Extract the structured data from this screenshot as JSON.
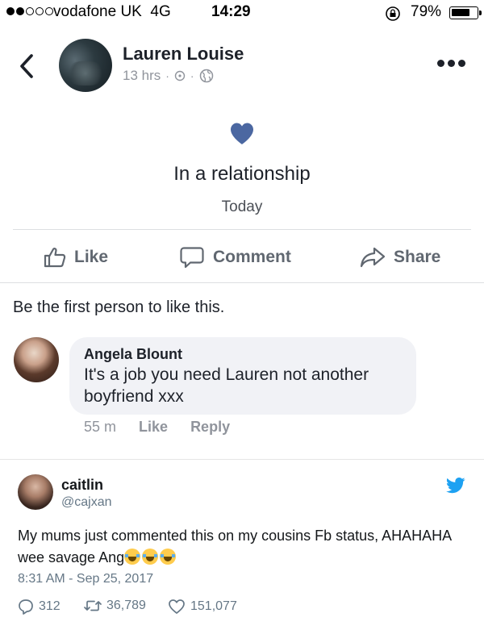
{
  "status_bar": {
    "carrier": "vodafone UK",
    "network": "4G",
    "time": "14:29",
    "battery_percent": "79%",
    "battery_level": 0.79,
    "signal_bars": 2,
    "signal_total": 5
  },
  "post": {
    "author": "Lauren Louise",
    "time": "13 hrs",
    "event_title": "In a relationship",
    "event_date": "Today",
    "heart_color": "#4b67a1",
    "actions": {
      "like": "Like",
      "comment": "Comment",
      "share": "Share"
    },
    "likes_summary": "Be the first person to like this."
  },
  "comment": {
    "author": "Angela Blount",
    "text": "It's a job you need Lauren not another boyfriend xxx",
    "time": "55 m",
    "like_label": "Like",
    "reply_label": "Reply"
  },
  "tweet": {
    "name": "caitlin",
    "handle": "@cajxan",
    "text": "My mums just commented this on my cousins Fb status, AHAHAHA wee savage Ang",
    "emoji_count": 3,
    "timestamp": "8:31 AM - Sep 25, 2017",
    "replies": "312",
    "retweets": "36,789",
    "likes": "151,077",
    "brand_color": "#1da1f2"
  }
}
